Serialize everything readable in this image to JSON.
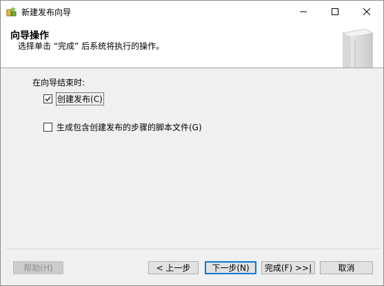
{
  "window": {
    "title": "新建发布向导",
    "min_icon": "minimize-icon",
    "max_icon": "maximize-icon",
    "close_icon": "close-icon"
  },
  "header": {
    "title": "向导操作",
    "subtitle": "选择单击 “完成” 后系统将执行的操作。"
  },
  "content": {
    "section_label": "在向导结束时:",
    "options": [
      {
        "label": "创建发布(C)",
        "checked": true
      },
      {
        "label": "生成包含创建发布的步骤的脚本文件(G)",
        "checked": false
      }
    ]
  },
  "buttons": {
    "help": "帮助(H)",
    "back": "< 上一步",
    "next": "下一步(N)",
    "finish": "完成(F) >>|",
    "cancel": "取消"
  },
  "colors": {
    "focus_border": "#0078d7",
    "dialog_bg": "#f0f0f0"
  }
}
